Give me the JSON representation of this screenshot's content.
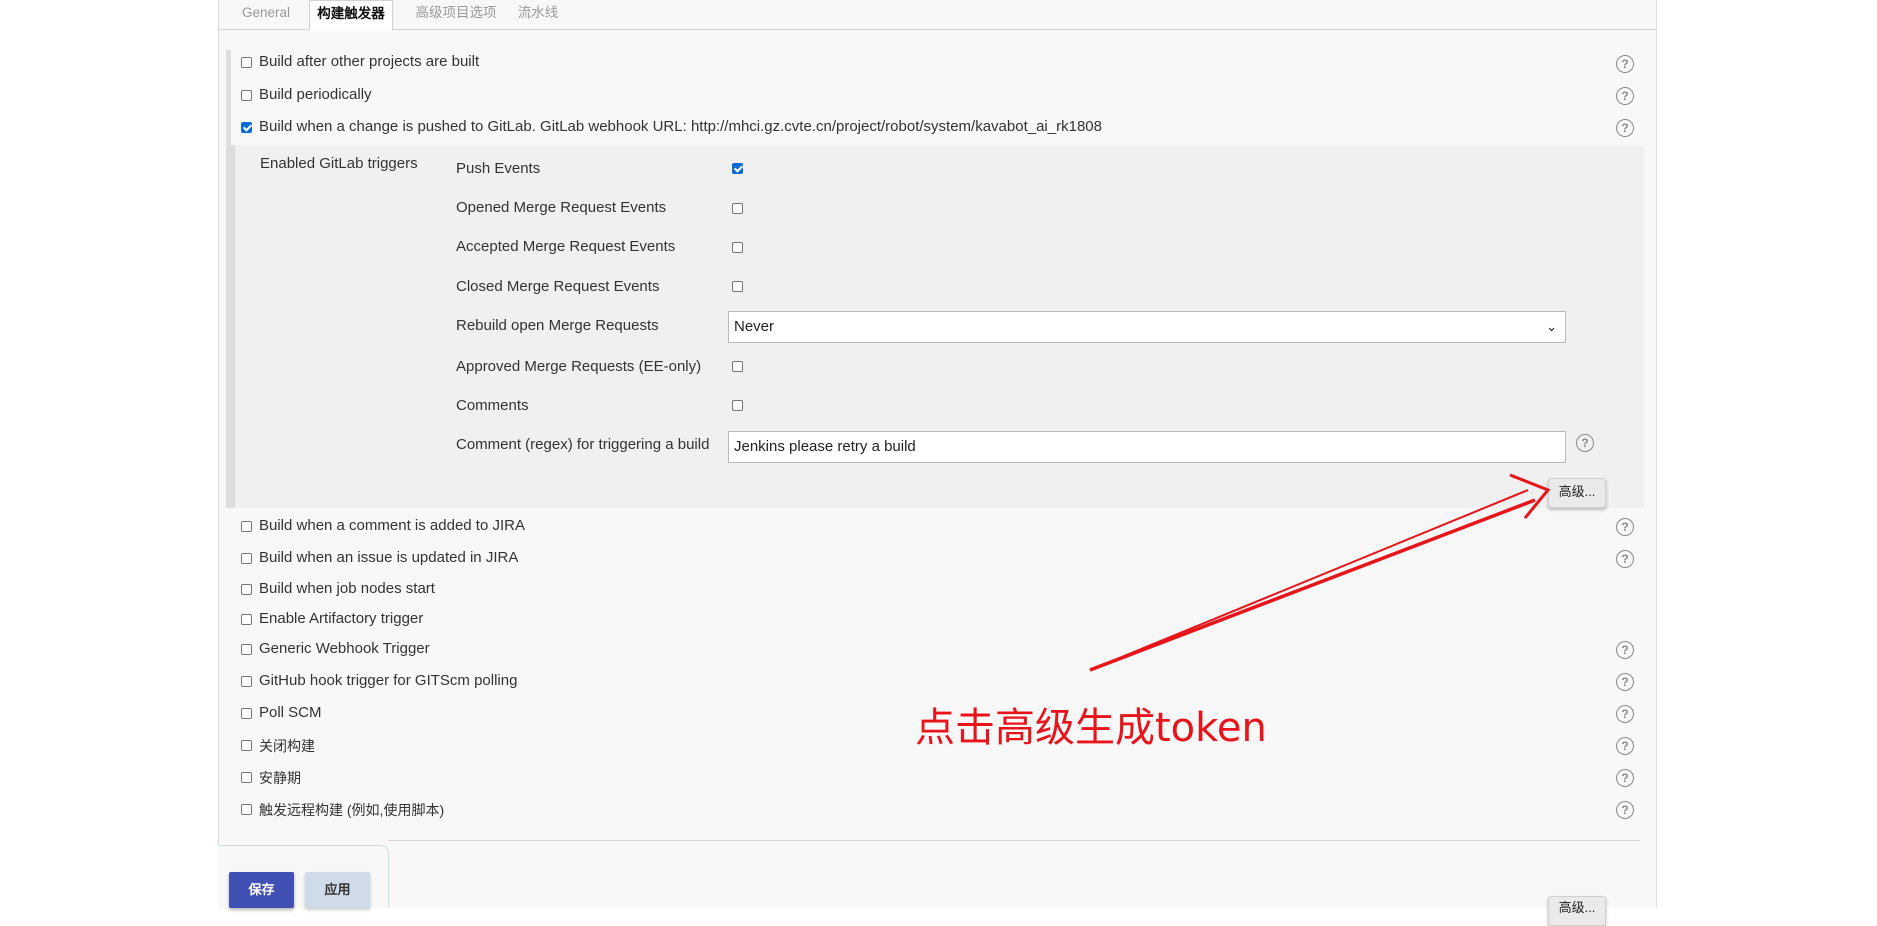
{
  "tabs": [
    "General",
    "构建触发器",
    "高级项目选项",
    "流水线"
  ],
  "triggers_top": [
    {
      "label": "Build after other projects are built",
      "checked": false,
      "help": true
    },
    {
      "label": "Build periodically",
      "checked": false,
      "help": true
    },
    {
      "label": "Build when a change is pushed to GitLab. GitLab webhook URL: http://mhci.gz.cvte.cn/project/robot/system/kavabot_ai_rk1808",
      "checked": true,
      "help": true
    }
  ],
  "gitlab": {
    "section_label": "Enabled GitLab triggers",
    "push_events": {
      "label": "Push Events",
      "checked": true
    },
    "opened_mr": {
      "label": "Opened Merge Request Events",
      "checked": false
    },
    "accepted_mr": {
      "label": "Accepted Merge Request Events",
      "checked": false
    },
    "closed_mr": {
      "label": "Closed Merge Request Events",
      "checked": false
    },
    "rebuild": {
      "label": "Rebuild open Merge Requests",
      "value": "Never"
    },
    "approved_mr": {
      "label": "Approved Merge Requests (EE-only)",
      "checked": false
    },
    "comments": {
      "label": "Comments",
      "checked": false
    },
    "comment_regex": {
      "label": "Comment (regex) for triggering a build",
      "value": "Jenkins please retry a build"
    },
    "advanced_button": "高级..."
  },
  "triggers_bottom": [
    {
      "label": "Build when a comment is added to JIRA",
      "checked": false,
      "help": true
    },
    {
      "label": "Build when an issue is updated in JIRA",
      "checked": false,
      "help": true
    },
    {
      "label": "Build when job nodes start",
      "checked": false,
      "help": false
    },
    {
      "label": "Enable Artifactory trigger",
      "checked": false,
      "help": false
    },
    {
      "label": "Generic Webhook Trigger",
      "checked": false,
      "help": true
    },
    {
      "label": "GitHub hook trigger for GITScm polling",
      "checked": false,
      "help": true
    },
    {
      "label": "Poll SCM",
      "checked": false,
      "help": true
    },
    {
      "label": "关闭构建",
      "checked": false,
      "help": true
    },
    {
      "label": "安静期",
      "checked": false,
      "help": true
    },
    {
      "label": "触发远程构建 (例如,使用脚本)",
      "checked": false,
      "help": true
    }
  ],
  "annotation": {
    "text": "点击高级生成token",
    "color": "#e8141a"
  },
  "footer": {
    "save": "保存",
    "apply": "应用",
    "advanced_partial": "高级..."
  },
  "colors": {
    "save": "#4050b5",
    "apply": "#cfdbe8",
    "checkbox_checked": "#0b6bd6"
  }
}
